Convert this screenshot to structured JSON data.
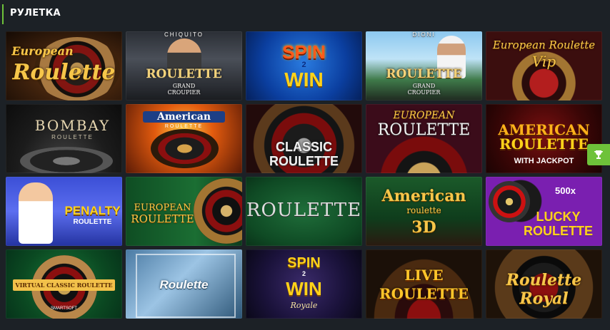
{
  "section": {
    "title": "РУЛЕТКА",
    "accent_color": "#6ec23a"
  },
  "side_button": {
    "icon": "trophy-icon",
    "color": "#6ec23a"
  },
  "tiles": [
    {
      "name": "european-roulette",
      "line1": "European",
      "line2": "Roulette"
    },
    {
      "name": "roulette-grand-croupier-chiquito",
      "top_text": "CHIQUITO",
      "line1": "ROULETTE",
      "line2": "GRAND",
      "line3": "CROUPIER"
    },
    {
      "name": "spin-2-win",
      "line1": "SPIN",
      "line2": "2",
      "line3": "WIN"
    },
    {
      "name": "roulette-grand-croupier-dioni",
      "top_text": "DIONI",
      "line1": "ROULETTE",
      "line2": "GRAND",
      "line3": "CROUPIER"
    },
    {
      "name": "european-roulette-vip",
      "line1": "European Roulette",
      "line2": "Vip"
    },
    {
      "name": "bombay-roulette",
      "line1": "BOMBAY",
      "line2": "ROULETTE"
    },
    {
      "name": "american-roulette",
      "line1": "American",
      "line2": "ROULETTE"
    },
    {
      "name": "classic-roulette",
      "line1": "CLASSIC",
      "line2": "ROULETTE"
    },
    {
      "name": "european-roulette-2",
      "line1": "EUROPEAN",
      "line2": "ROULETTE"
    },
    {
      "name": "american-roulette-jackpot",
      "line1": "AMERICAN",
      "line2": "ROULETTE",
      "line3": "WITH JACKPOT"
    },
    {
      "name": "penalty-roulette",
      "line1": "PENALTY",
      "line2": "ROULETTE"
    },
    {
      "name": "european-roulette-3",
      "line1": "EUROPEAN",
      "line2": "ROULETTE"
    },
    {
      "name": "roulette-green",
      "line1": "ROULETTE"
    },
    {
      "name": "american-roulette-3d",
      "line1": "American",
      "line2": "roulette",
      "line3": "3D"
    },
    {
      "name": "lucky-roulette",
      "line1": "500x",
      "line2": "LUCKY",
      "line3": "ROULETTE"
    },
    {
      "name": "virtual-classic-roulette",
      "line1": "VIRTUAL CLASSIC ROULETTE",
      "line2": "SMARTSOFT"
    },
    {
      "name": "roulette-blue",
      "line1": "Roulette"
    },
    {
      "name": "spin-2-win-royale",
      "line1": "SPIN",
      "line2": "2",
      "line3": "WIN",
      "line4": "Royale"
    },
    {
      "name": "live-roulette",
      "line1": "LIVE",
      "line2": "ROULETTE"
    },
    {
      "name": "roulette-royal",
      "line1": "Roulette",
      "line2": "Royal"
    }
  ]
}
